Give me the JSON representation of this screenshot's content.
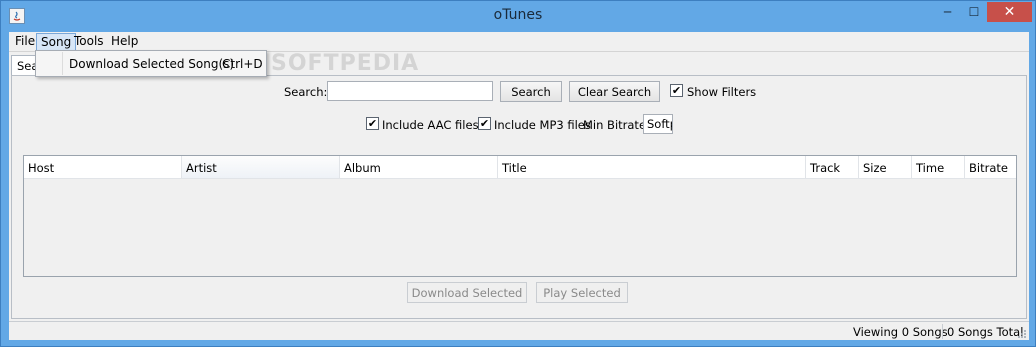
{
  "window": {
    "title": "oTunes",
    "icon": "java-app-icon",
    "controls": {
      "minimize": "─",
      "maximize": "☐",
      "close": "✕"
    }
  },
  "menubar": {
    "items": [
      {
        "label": "File"
      },
      {
        "label": "Song"
      },
      {
        "label": "Tools"
      },
      {
        "label": "Help"
      }
    ]
  },
  "song_menu": {
    "items": [
      {
        "label": "Download Selected Song(s)",
        "shortcut": "Ctrl+D"
      }
    ]
  },
  "tabs": [
    {
      "label": "Search"
    }
  ],
  "search": {
    "label": "Search:",
    "value": "",
    "search_button": "Search",
    "clear_button": "Clear Search",
    "show_filters_label": "Show Filters",
    "show_filters_checked": true
  },
  "filters": {
    "include_aac_label": "Include AAC files",
    "include_aac_checked": true,
    "include_mp3_label": "Include MP3 files",
    "include_mp3_checked": true,
    "min_bitrate_label": "Min Bitrate:",
    "min_bitrate_value": "Softp"
  },
  "table": {
    "columns": [
      "Host",
      "Artist",
      "Album",
      "Title",
      "Track",
      "Size",
      "Time",
      "Bitrate"
    ],
    "rows": []
  },
  "actions": {
    "download_selected": "Download Selected",
    "play_selected": "Play Selected"
  },
  "status": {
    "viewing": "Viewing 0 Songs",
    "total": "0 Songs Total"
  },
  "watermark": "SOFTPEDIA",
  "colors": {
    "titlebar": "#62a8e6",
    "close_button": "#c7504a",
    "menu_highlight": "#d7e6f7"
  }
}
